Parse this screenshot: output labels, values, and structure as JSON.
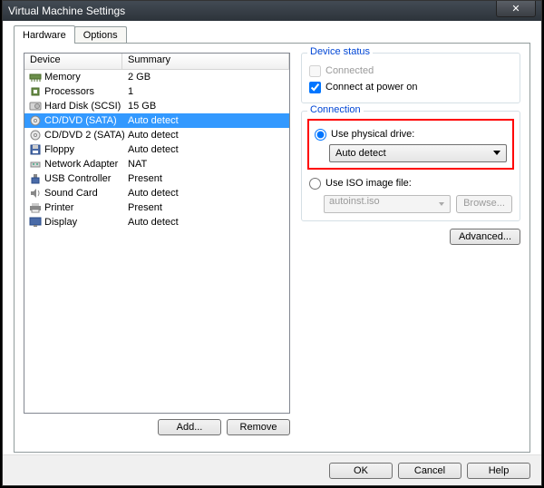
{
  "window": {
    "title": "Virtual Machine Settings"
  },
  "tabs": {
    "hardware": "Hardware",
    "options": "Options"
  },
  "device_list": {
    "header_device": "Device",
    "header_summary": "Summary",
    "rows": [
      {
        "device": "Memory",
        "summary": "2 GB",
        "icon": "memory"
      },
      {
        "device": "Processors",
        "summary": "1",
        "icon": "cpu"
      },
      {
        "device": "Hard Disk (SCSI)",
        "summary": "15 GB",
        "icon": "hdd"
      },
      {
        "device": "CD/DVD (SATA)",
        "summary": "Auto detect",
        "icon": "cd",
        "selected": true
      },
      {
        "device": "CD/DVD 2 (SATA)",
        "summary": "Auto detect",
        "icon": "cd"
      },
      {
        "device": "Floppy",
        "summary": "Auto detect",
        "icon": "floppy"
      },
      {
        "device": "Network Adapter",
        "summary": "NAT",
        "icon": "net"
      },
      {
        "device": "USB Controller",
        "summary": "Present",
        "icon": "usb"
      },
      {
        "device": "Sound Card",
        "summary": "Auto detect",
        "icon": "sound"
      },
      {
        "device": "Printer",
        "summary": "Present",
        "icon": "printer"
      },
      {
        "device": "Display",
        "summary": "Auto detect",
        "icon": "display"
      }
    ]
  },
  "buttons": {
    "add": "Add...",
    "remove": "Remove",
    "browse": "Browse...",
    "advanced": "Advanced...",
    "ok": "OK",
    "cancel": "Cancel",
    "help": "Help"
  },
  "device_status": {
    "legend": "Device status",
    "connected": "Connected",
    "connected_checked": false,
    "connect_power": "Connect at power on",
    "connect_power_checked": true
  },
  "connection": {
    "legend": "Connection",
    "use_physical": "Use physical drive:",
    "physical_value": "Auto detect",
    "use_iso": "Use ISO image file:",
    "iso_value": "autoinst.iso",
    "selected": "physical"
  }
}
